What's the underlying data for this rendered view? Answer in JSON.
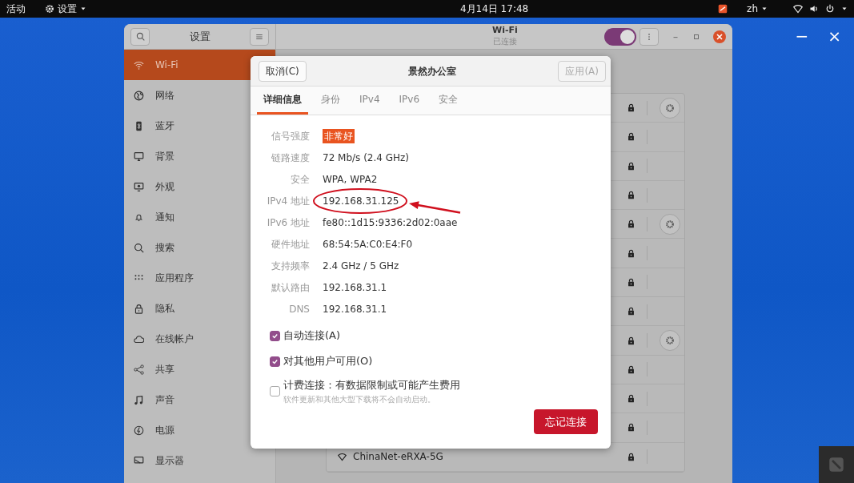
{
  "top_bar": {
    "activities": "活动",
    "app_menu": "设置",
    "clock": "4月14日 17:48",
    "language": "zh"
  },
  "desktop_controls": [
    "−",
    "×"
  ],
  "settings_window": {
    "sidebar_title": "设置",
    "page_title": "Wi-Fi",
    "page_subtitle": "已连接",
    "wifi_on": true
  },
  "sidebar": {
    "items": [
      {
        "label": "Wi-Fi",
        "selected": true
      },
      {
        "label": "网络",
        "selected": false
      },
      {
        "label": "蓝牙",
        "selected": false
      },
      {
        "label": "背景",
        "selected": false
      },
      {
        "label": "外观",
        "selected": false
      },
      {
        "label": "通知",
        "selected": false
      },
      {
        "label": "搜索",
        "selected": false
      },
      {
        "label": "应用程序",
        "selected": false
      },
      {
        "label": "隐私",
        "selected": false
      },
      {
        "label": "在线帐户",
        "selected": false
      },
      {
        "label": "共享",
        "selected": false
      },
      {
        "label": "声音",
        "selected": false
      },
      {
        "label": "电源",
        "selected": false
      },
      {
        "label": "显示器",
        "selected": false
      }
    ]
  },
  "networks": [
    {
      "settings": true
    },
    {
      "settings": false
    },
    {
      "settings": false
    },
    {
      "settings": false
    },
    {
      "settings": true
    },
    {
      "settings": false
    },
    {
      "settings": false
    },
    {
      "settings": false
    },
    {
      "settings": true
    },
    {
      "settings": false
    },
    {
      "settings": false
    },
    {
      "settings": false
    },
    {
      "settings": false,
      "name": "ChinaNet-eRXA-5G"
    }
  ],
  "dialog": {
    "title": "景然办公室",
    "cancel": "取消(C)",
    "apply": "应用(A)",
    "apply_disabled": true,
    "tabs": [
      {
        "label": "详细信息",
        "selected": true
      },
      {
        "label": "身份",
        "selected": false
      },
      {
        "label": "IPv4",
        "selected": false
      },
      {
        "label": "IPv6",
        "selected": false
      },
      {
        "label": "安全",
        "selected": false
      }
    ],
    "details": [
      {
        "label": "信号强度",
        "value": "非常好",
        "highlighted": true
      },
      {
        "label": "链路速度",
        "value": "72 Mb/s (2.4 GHz)",
        "highlighted": false
      },
      {
        "label": "安全",
        "value": "WPA, WPA2",
        "highlighted": false
      },
      {
        "label": "IPv4 地址",
        "value": "192.168.31.125",
        "highlighted": false
      },
      {
        "label": "IPv6 地址",
        "value": "fe80::1d15:9336:2d02:0aae",
        "highlighted": false
      },
      {
        "label": "硬件地址",
        "value": "68:54:5A:C0:E4:F0",
        "highlighted": false
      },
      {
        "label": "支持频率",
        "value": "2.4 GHz / 5 GHz",
        "highlighted": false
      },
      {
        "label": "默认路由",
        "value": "192.168.31.1",
        "highlighted": false
      },
      {
        "label": "DNS",
        "value": "192.168.31.1",
        "highlighted": false
      }
    ],
    "options": [
      {
        "label": "自动连接(A)",
        "checked": true
      },
      {
        "label": "对其他用户可用(O)",
        "checked": true
      },
      {
        "label": "计费连接：有数据限制或可能产生费用",
        "hint": "软件更新和其他大型下载将不会自动启动。",
        "checked": false
      }
    ],
    "forget": "忘记连接"
  }
}
